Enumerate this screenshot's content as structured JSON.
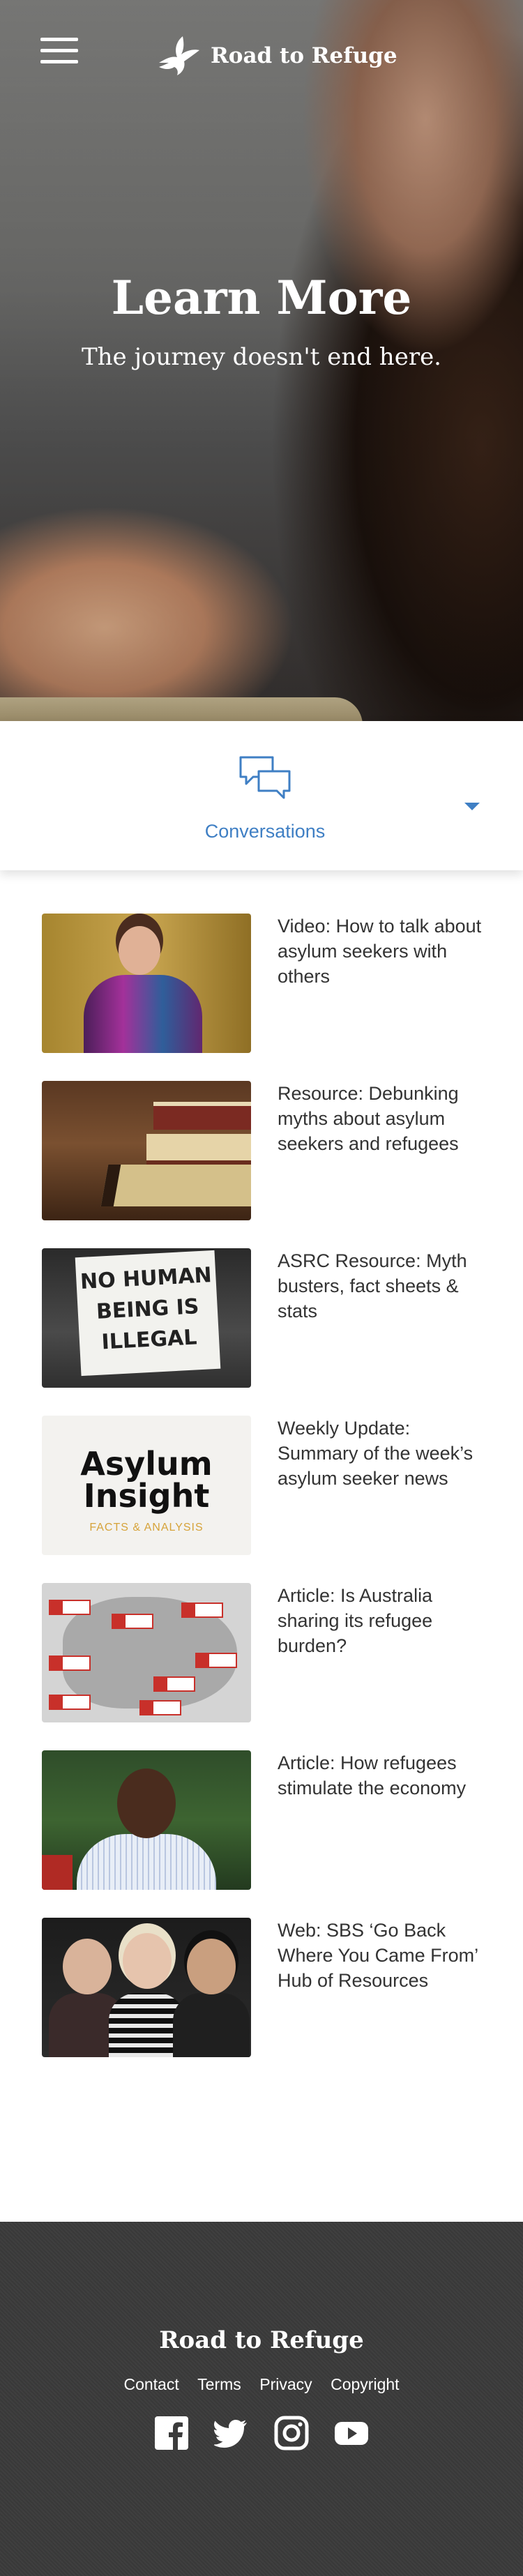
{
  "header": {
    "brand": "Road to Refuge"
  },
  "hero": {
    "title": "Learn More",
    "subtitle": "The journey doesn't end here."
  },
  "tabs": {
    "active_label": "Conversations"
  },
  "items": [
    {
      "title": "Video: How to talk about asylum seekers with others"
    },
    {
      "title": "Resource: Debunking myths about asylum seekers and refugees"
    },
    {
      "title": "ASRC Resource: Myth busters, fact sheets & stats"
    },
    {
      "title": "Weekly Update: Summary of the week’s asylum seeker news"
    },
    {
      "title": "Article: Is Australia sharing its refugee burden?"
    },
    {
      "title": "Article: How refugees stimulate the economy"
    },
    {
      "title": "Web: SBS ‘Go Back Where You Came From’ Hub of Resources"
    }
  ],
  "thumbnails": {
    "sign_line1": "NO HUMAN",
    "sign_line2": "BEING IS",
    "sign_line3": "ILLEGAL",
    "asylum_insight_line1": "Asylum",
    "asylum_insight_line2": "Insight",
    "asylum_insight_sub": "FACTS & ANALYSIS"
  },
  "footer": {
    "brand": "Road to Refuge",
    "links": [
      "Contact",
      "Terms",
      "Privacy",
      "Copyright"
    ],
    "socials": [
      "facebook-icon",
      "twitter-icon",
      "instagram-icon",
      "youtube-icon"
    ]
  },
  "colors": {
    "accent": "#3f7fc4",
    "footer_bg": "#3b3b3b"
  }
}
